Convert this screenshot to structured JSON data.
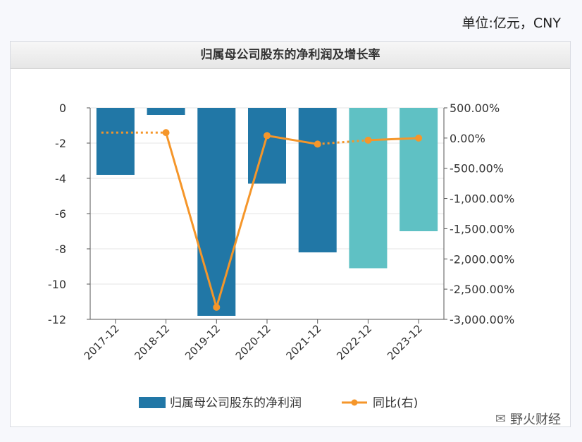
{
  "unit_label": "单位:亿元，CNY",
  "panel_title": "归属母公司股东的净利润及增长率",
  "watermark": {
    "icon": "wechat-icon",
    "text": "野火财经"
  },
  "colors": {
    "bar_actual": "#2177a6",
    "bar_forecast": "#5fc1c4",
    "line": "#f5962a"
  },
  "chart_data": {
    "type": "bar",
    "title": "归属母公司股东的净利润及增长率",
    "categories": [
      "2017-12",
      "2018-12",
      "2019-12",
      "2020-12",
      "2021-12",
      "2022-12",
      "2023-12"
    ],
    "series": [
      {
        "name": "归属母公司股东的净利润",
        "type": "bar",
        "axis": "left",
        "values": [
          -3.8,
          -0.4,
          -11.8,
          -4.3,
          -8.2,
          -9.1,
          -7.0
        ],
        "forecast": [
          false,
          false,
          false,
          false,
          false,
          true,
          true
        ]
      },
      {
        "name": "同比(右)",
        "type": "line",
        "axis": "right",
        "values": [
          null,
          90,
          -2800,
          40,
          -100,
          -35,
          0
        ],
        "dotted_segments": [
          [
            0,
            1
          ],
          [
            4,
            5
          ]
        ]
      }
    ],
    "left_axis": {
      "ylim": [
        -12,
        0
      ],
      "ticks": [
        "0",
        "-2",
        "-4",
        "-6",
        "-8",
        "-10",
        "-12"
      ]
    },
    "right_axis": {
      "ylim": [
        -3000,
        500
      ],
      "ticks": [
        "500.00%",
        "0.00%",
        "-500.00%",
        "-1,000.00%",
        "-1,500.00%",
        "-2,000.00%",
        "-2,500.00%",
        "-3,000.00%"
      ]
    },
    "grid": true,
    "legend": {
      "position": "bottom",
      "items": [
        "归属母公司股东的净利润",
        "同比(右)"
      ]
    }
  }
}
